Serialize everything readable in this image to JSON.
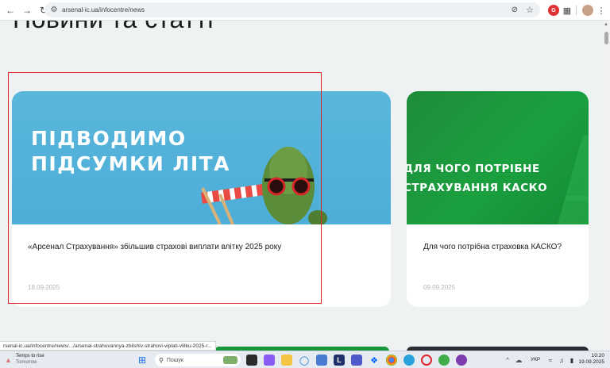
{
  "browser": {
    "url": "arsenal-ic.ua/infocentre/news",
    "icons": [
      "back-icon",
      "forward-icon",
      "reload-icon",
      "site-settings-icon",
      "eye-off-icon",
      "star-icon",
      "extension-badge-icon",
      "puzzle-icon",
      "profile-avatar",
      "menu-icon"
    ]
  },
  "page": {
    "heading": "Новини та статті"
  },
  "cards": [
    {
      "image_text": "ПІДВОДИМО\nПІДСУМКИ ЛІТА",
      "title": "«Арсенал Страхування» збільшив страхові виплати влітку 2025 року",
      "date": "18.09.2025",
      "image_color": "#55b3da"
    },
    {
      "image_text": "ДЛЯ ЧОГО ПОТРІБНЕ\nСТРАХУВАННЯ КАСКО",
      "title": "Для чого потрібна страховка КАСКО?",
      "date": "09.09.2025",
      "image_color": "#1a9a3c"
    }
  ],
  "status_bar": {
    "link": "rsenal-ic.ua/infocentre/news/.../arsenal-strahuvannya-zbilshiv-strahovi-viplati-vlitku-2025-r..."
  },
  "taskbar": {
    "weather_title": "Temps to rise",
    "weather_sub": "Tomorrow",
    "search_placeholder": "Пошук",
    "language": "УКР",
    "time": "10:20",
    "date": "19.09.2025"
  },
  "colors": {
    "highlight": "#e02222",
    "date_text": "#b3b8bc"
  }
}
